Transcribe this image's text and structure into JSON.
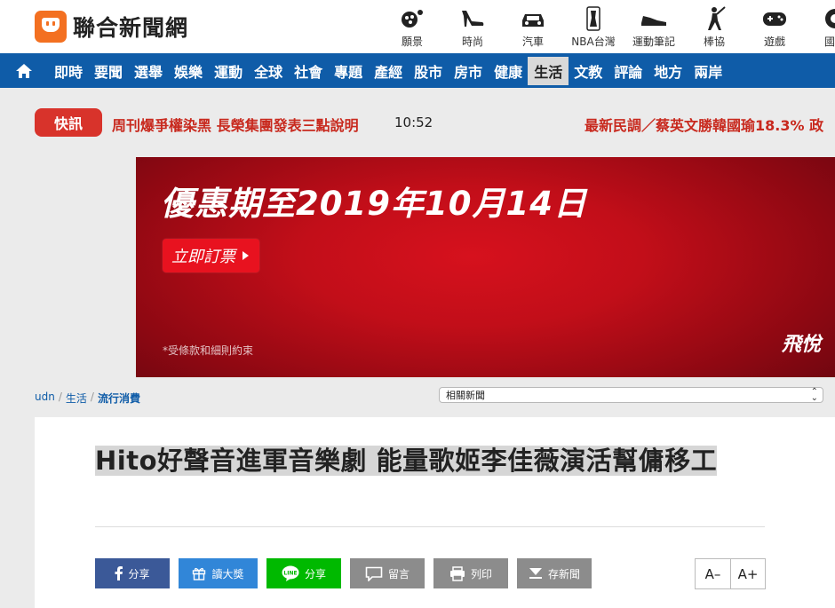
{
  "header": {
    "site_name": "聯合新聞網",
    "top_categories": [
      {
        "label": "願景",
        "icon": "vision-icon"
      },
      {
        "label": "時尚",
        "icon": "high-heel-icon"
      },
      {
        "label": "汽車",
        "icon": "car-icon"
      },
      {
        "label": "NBA台灣",
        "icon": "nba-icon"
      },
      {
        "label": "運動筆記",
        "icon": "sneaker-icon"
      },
      {
        "label": "棒協",
        "icon": "baseball-player-icon"
      },
      {
        "label": "遊戲",
        "icon": "gamepad-icon"
      },
      {
        "label": "國際",
        "icon": "globe-icon"
      }
    ]
  },
  "nav": {
    "items": [
      "即時",
      "要聞",
      "選舉",
      "娛樂",
      "運動",
      "全球",
      "社會",
      "專題",
      "產經",
      "股市",
      "房市",
      "健康",
      "生活",
      "文教",
      "評論",
      "地方",
      "兩岸"
    ],
    "active": "生活"
  },
  "flash": {
    "badge": "快訊",
    "headline": "周刊爆爭權染黑 長榮集團發表三點說明",
    "time": "10:52",
    "right_headline": "最新民調／蔡英文勝韓國瑜18.3% 政"
  },
  "ad": {
    "headline": "優惠期至2019年10月14日",
    "button": "立即訂票",
    "disclaimer": "*受條款和細則約束",
    "brand": "飛悅"
  },
  "breadcrumb": {
    "items": [
      "udn",
      "生活",
      "流行消費"
    ],
    "separator": "/"
  },
  "related": {
    "selected": "相關新聞"
  },
  "article": {
    "title": "Hito好聲音進軍音樂劇 能量歌姬李佳薇演活幫傭移工"
  },
  "share": {
    "facebook": "分享",
    "gift": "讀大獎",
    "line": "分享",
    "comment": "留言",
    "print": "列印",
    "save": "存新聞"
  },
  "font_controls": {
    "decrease": "A–",
    "increase": "A+"
  },
  "colors": {
    "brand_orange": "#f37021",
    "nav_blue": "#0f5ca8",
    "flash_red": "#d8332b",
    "facebook": "#3b5998",
    "line_green": "#00b900"
  }
}
